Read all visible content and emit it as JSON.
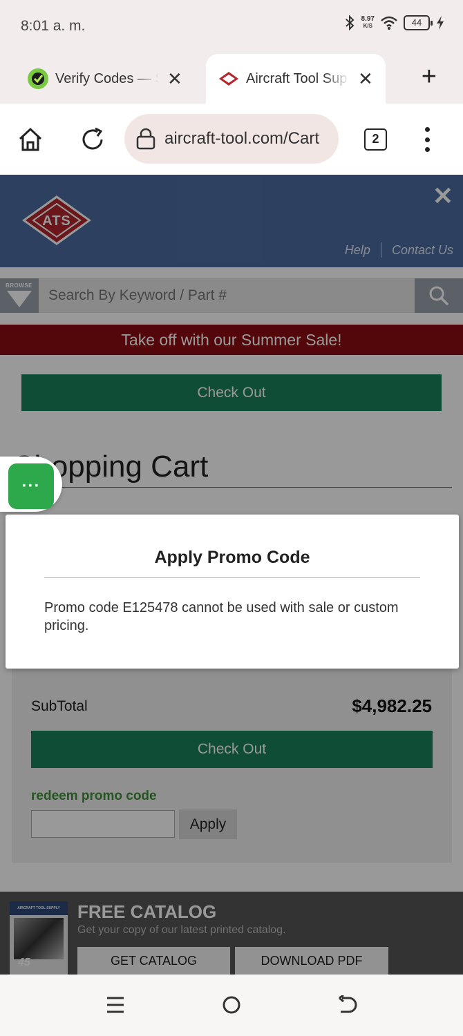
{
  "status_bar": {
    "time": "8:01 a. m.",
    "net_speed_value": "8.97",
    "net_speed_unit": "K/S",
    "battery": "44"
  },
  "tabs": [
    {
      "title": "Verify Codes — S",
      "icon": "verify-codes-favicon"
    },
    {
      "title": "Aircraft Tool Sup",
      "icon": "ats-favicon"
    }
  ],
  "address_bar": {
    "url": "aircraft-tool.com/Cart",
    "tab_count": "2"
  },
  "site_header": {
    "logo_text": "ATS",
    "help_link": "Help",
    "contact_link": "Contact Us"
  },
  "search": {
    "browse_label": "BROWSE",
    "placeholder": "Search By Keyword / Part #"
  },
  "banner": {
    "text": "Take off with our Summer Sale!"
  },
  "cart": {
    "checkout_label": "Check Out",
    "title": "Shopping Cart",
    "subtotal_label": "SubTotal",
    "subtotal_value": "$4,982.25",
    "redeem_label": "redeem promo code",
    "apply_label": "Apply"
  },
  "catalog": {
    "cover_brand": "AIRCRAFT TOOL SUPPLY COMPANY",
    "cover_number": "45",
    "title": "FREE CATALOG",
    "subtitle": "Get your copy of our latest printed catalog.",
    "get_label": "GET CATALOG",
    "pdf_label": "DOWNLOAD PDF"
  },
  "modal": {
    "title": "Apply Promo Code",
    "message": "Promo code E125478 cannot be used with sale or custom pricing."
  },
  "chat": {
    "label": "···"
  },
  "colors": {
    "header_blue": "#4c6ca1",
    "banner_red": "#8b0c12",
    "checkout_green": "#19815c",
    "redeem_green": "#3f8e36",
    "chat_green": "#2da84b"
  }
}
